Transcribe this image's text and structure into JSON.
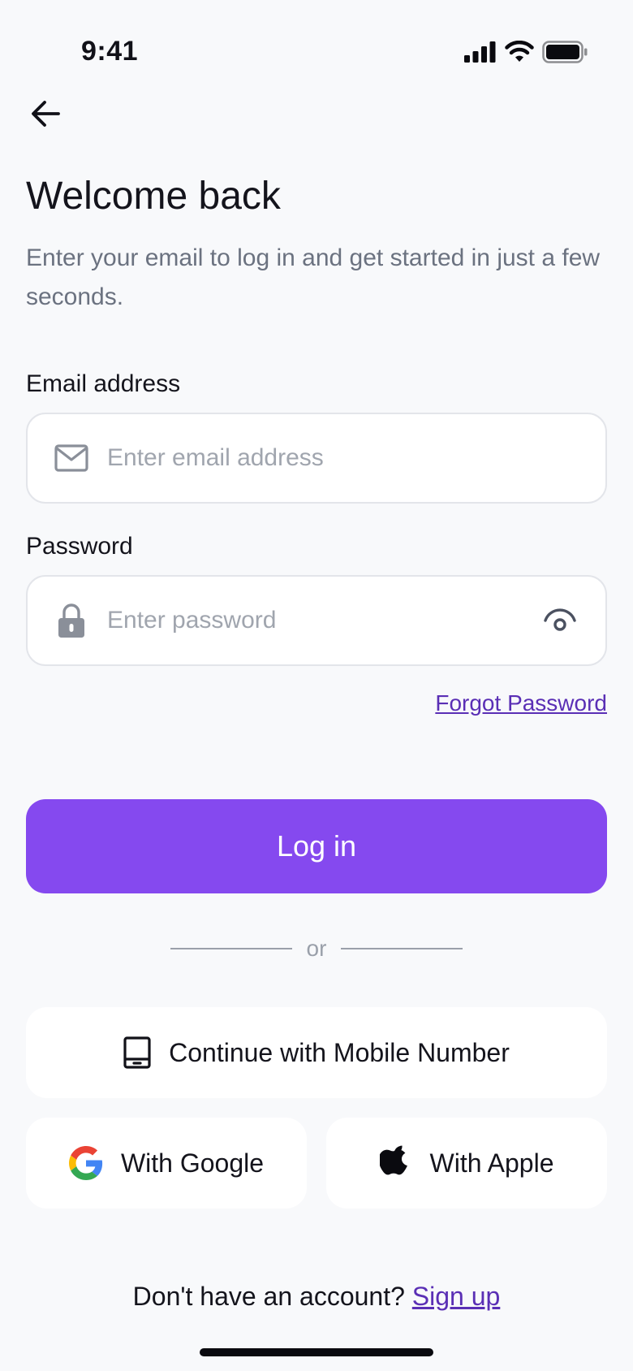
{
  "status_bar": {
    "time": "9:41"
  },
  "header": {
    "title": "Welcome back",
    "subtitle": "Enter your email to log in and get started in just a few seconds."
  },
  "form": {
    "email": {
      "label": "Email address",
      "placeholder": "Enter email address",
      "value": ""
    },
    "password": {
      "label": "Password",
      "placeholder": "Enter password",
      "value": ""
    },
    "forgot_label": "Forgot Password",
    "login_label": "Log in"
  },
  "divider_text": "or",
  "social": {
    "mobile_label": "Continue with Mobile Number",
    "google_label": "With Google",
    "apple_label": "With Apple"
  },
  "footer": {
    "prompt": "Don't have an account?",
    "signup_label": "Sign up"
  },
  "colors": {
    "accent": "#8549EF",
    "link": "#5A2FB5",
    "background": "#F8F9FB"
  }
}
